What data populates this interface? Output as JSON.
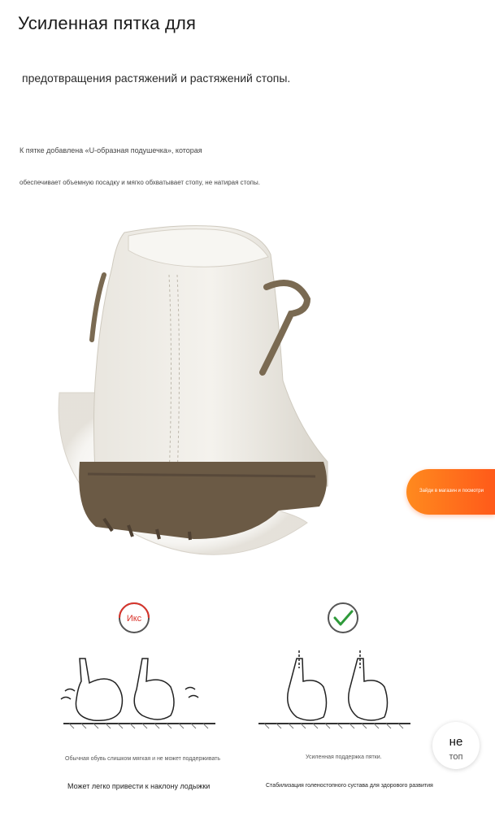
{
  "header": {
    "title": "Усиленная пятка для",
    "subtitle": "предотвращения растяжений и растяжений стопы."
  },
  "description": {
    "line1": "К пятке добавлена «U-образная подушечка», которая",
    "line2": "обеспечивает объемную посадку и мягко обхватывает стопу, не натирая стопы."
  },
  "floating_chat": {
    "label": "Зайди в магазин и посмотри"
  },
  "comparison": {
    "bad_badge": "Икс",
    "bad_caption": "Обычная обувь слишком мягкая и не может поддерживать",
    "bad_main": "Может легко привести к наклону лодыжки",
    "good_caption": "Усиленная поддержка пятки.",
    "good_main": "Стабилизация голеностопного сустава для здорового развития"
  },
  "back_to_top": {
    "line1": "не",
    "line2": "топ"
  },
  "colors": {
    "accent_orange": "#ff6a1a",
    "check_green": "#2e9a3a",
    "bad_red": "#d9342b",
    "sole_brown": "#6b5a45"
  }
}
